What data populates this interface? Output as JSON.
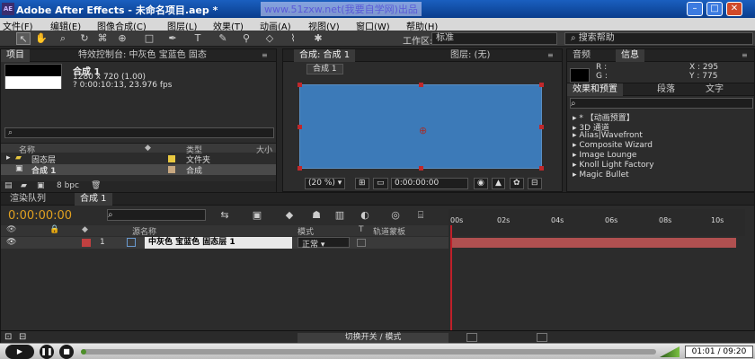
{
  "window": {
    "title": "Adobe After Effects - 未命名项目.aep *",
    "watermark": "www.51zxw.net(我要自学网)出品",
    "app_icon": "AE"
  },
  "menu": [
    "文件(F)",
    "编辑(E)",
    "图像合成(C)",
    "图层(L)",
    "效果(T)",
    "动画(A)",
    "视图(V)",
    "窗口(W)",
    "帮助(H)"
  ],
  "toolbar": {
    "workspace_label": "工作区:",
    "workspace_value": "标准",
    "help_search": "搜索帮助"
  },
  "project_panel": {
    "tabs": [
      "项目",
      "特效控制台: 中灰色 宝蓝色 固态"
    ],
    "selected": {
      "name": "合成 1",
      "size": "1280 x 720 (1.00)",
      "duration": "? 0:00:10:13, 23.976 fps"
    },
    "columns": {
      "name": "名称",
      "type": "类型",
      "size": "大小"
    },
    "items": [
      {
        "name": "固态层",
        "type": "文件夹",
        "color": "#e8c840"
      },
      {
        "name": "合成 1",
        "type": "合成",
        "color": "#c8a880"
      }
    ],
    "bpc": "8 bpc"
  },
  "comp_viewer": {
    "tabs": [
      "合成: 合成 1",
      "图层: (无)"
    ],
    "sub_tab": "合成 1",
    "zoom": "(20 %)",
    "timecode": "0:00:00:00",
    "solid_color": "#3c7ab8"
  },
  "info_panel": {
    "tabs": [
      "音频",
      "信息"
    ],
    "r_label": "R :",
    "g_label": "G :",
    "x": "X : 295",
    "y": "Y : 775"
  },
  "effects_panel": {
    "tabs": [
      "效果和预置",
      "段落",
      "文字"
    ],
    "items": [
      "* 【动画预置】",
      "3D 通道",
      "Alias|Wavefront",
      "Composite Wizard",
      "Image Lounge",
      "Knoll Light Factory",
      "Magic Bullet"
    ]
  },
  "timeline": {
    "tabs": [
      "渲染队列",
      "合成 1"
    ],
    "current_time": "0:00:00:00",
    "columns": {
      "source": "源名称",
      "mode": "模式",
      "t": "T",
      "trkmat": "轨道蒙板"
    },
    "ticks": [
      "00s",
      "02s",
      "04s",
      "06s",
      "08s",
      "10s"
    ],
    "layer": {
      "index": "1",
      "name": "中灰色 宝蓝色 固态层 1",
      "mode": "正常",
      "label_color": "#c04040"
    },
    "toggle_label": "切换开关 / 模式"
  },
  "player": {
    "time": "01:01 / 09:20",
    "progress": 0.01
  }
}
